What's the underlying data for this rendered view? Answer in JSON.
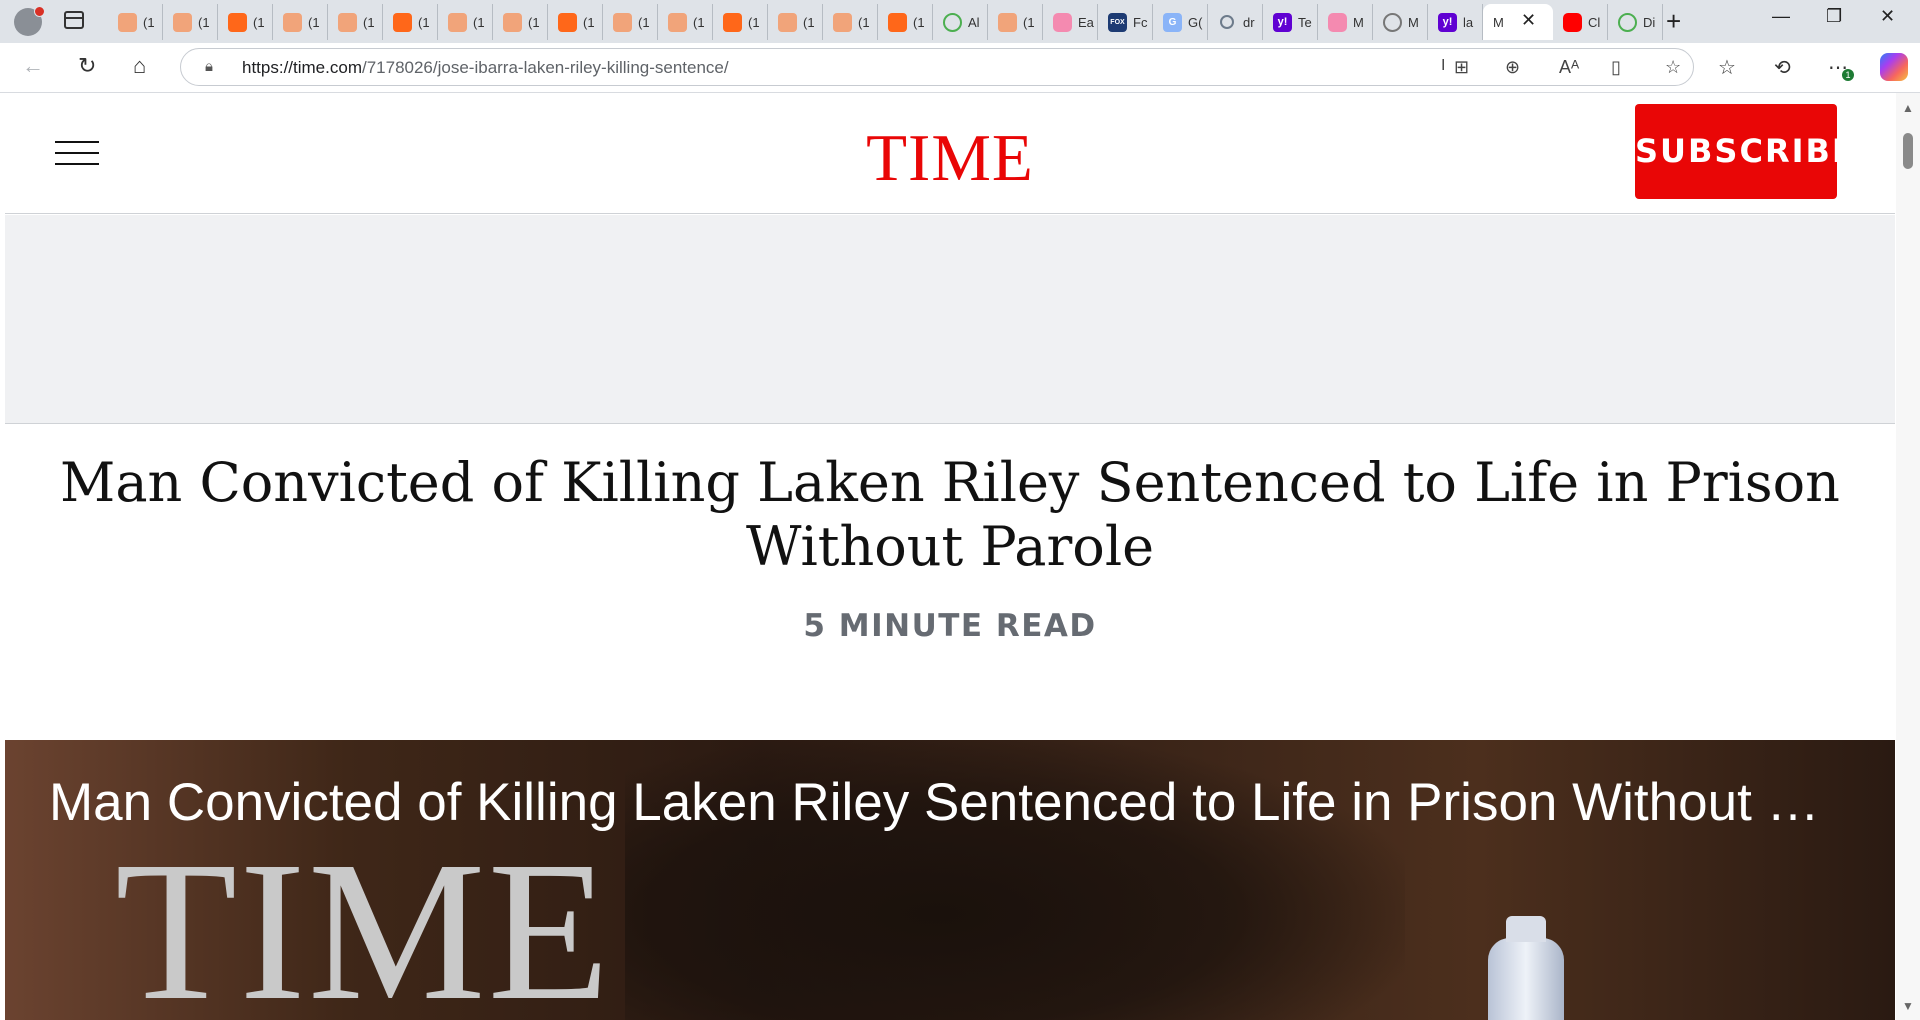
{
  "browser": {
    "tabs": [
      {
        "icon": "substack-icon",
        "title": "(1"
      },
      {
        "icon": "substack-icon",
        "title": "(1"
      },
      {
        "icon": "substack-icon",
        "title": "(1"
      },
      {
        "icon": "substack-icon",
        "title": "(1"
      },
      {
        "icon": "substack-icon",
        "title": "(1"
      },
      {
        "icon": "substack-icon",
        "title": "(1"
      },
      {
        "icon": "substack-icon",
        "title": "(1"
      },
      {
        "icon": "substack-icon",
        "title": "(1"
      },
      {
        "icon": "substack-icon",
        "title": "(1"
      },
      {
        "icon": "substack-icon",
        "title": "(1"
      },
      {
        "icon": "substack-icon",
        "title": "(1"
      },
      {
        "icon": "substack-icon",
        "title": "(1"
      },
      {
        "icon": "substack-icon",
        "title": "(1"
      },
      {
        "icon": "substack-icon",
        "title": "(1"
      },
      {
        "icon": "substack-icon",
        "title": "(1"
      },
      {
        "icon": "play-icon",
        "title": "Al"
      },
      {
        "icon": "substack-icon",
        "title": "(1"
      },
      {
        "icon": "youtube-icon",
        "title": "Ea"
      },
      {
        "icon": "fox-news-icon",
        "title": "Fc"
      },
      {
        "icon": "g-icon",
        "title": "G("
      },
      {
        "icon": "search-icon",
        "title": "dr"
      },
      {
        "icon": "yahoo-icon",
        "title": "Te"
      },
      {
        "icon": "youtube-icon",
        "title": "M"
      },
      {
        "icon": "brain-icon",
        "title": "M"
      },
      {
        "icon": "yahoo-icon",
        "title": "la"
      }
    ],
    "active_tab": {
      "title": "M",
      "close": "✕"
    },
    "after_tabs": [
      {
        "icon": "youtube-icon",
        "title": "Cl"
      },
      {
        "icon": "play-icon",
        "title": "Di"
      }
    ],
    "new_tab": "+",
    "url_host": "https://time.com",
    "url_path": "/7178026/jose-ibarra-laken-riley-killing-sentence/",
    "extension_badge": "1"
  },
  "site": {
    "logo": "TIME",
    "subscribe_label": "SUBSCRIBE"
  },
  "article": {
    "headline": "Man Convicted of Killing Laken Riley Sentenced to Life in Prison Without Parole",
    "read_time": "5 MINUTE READ"
  },
  "video": {
    "title": "Man Convicted of Killing Laken Riley Sentenced to Life in Prison Without Parole",
    "watermark": "TIME"
  },
  "colors": {
    "brand_red": "#e90606",
    "tab_bar": "#dfe3e8"
  }
}
